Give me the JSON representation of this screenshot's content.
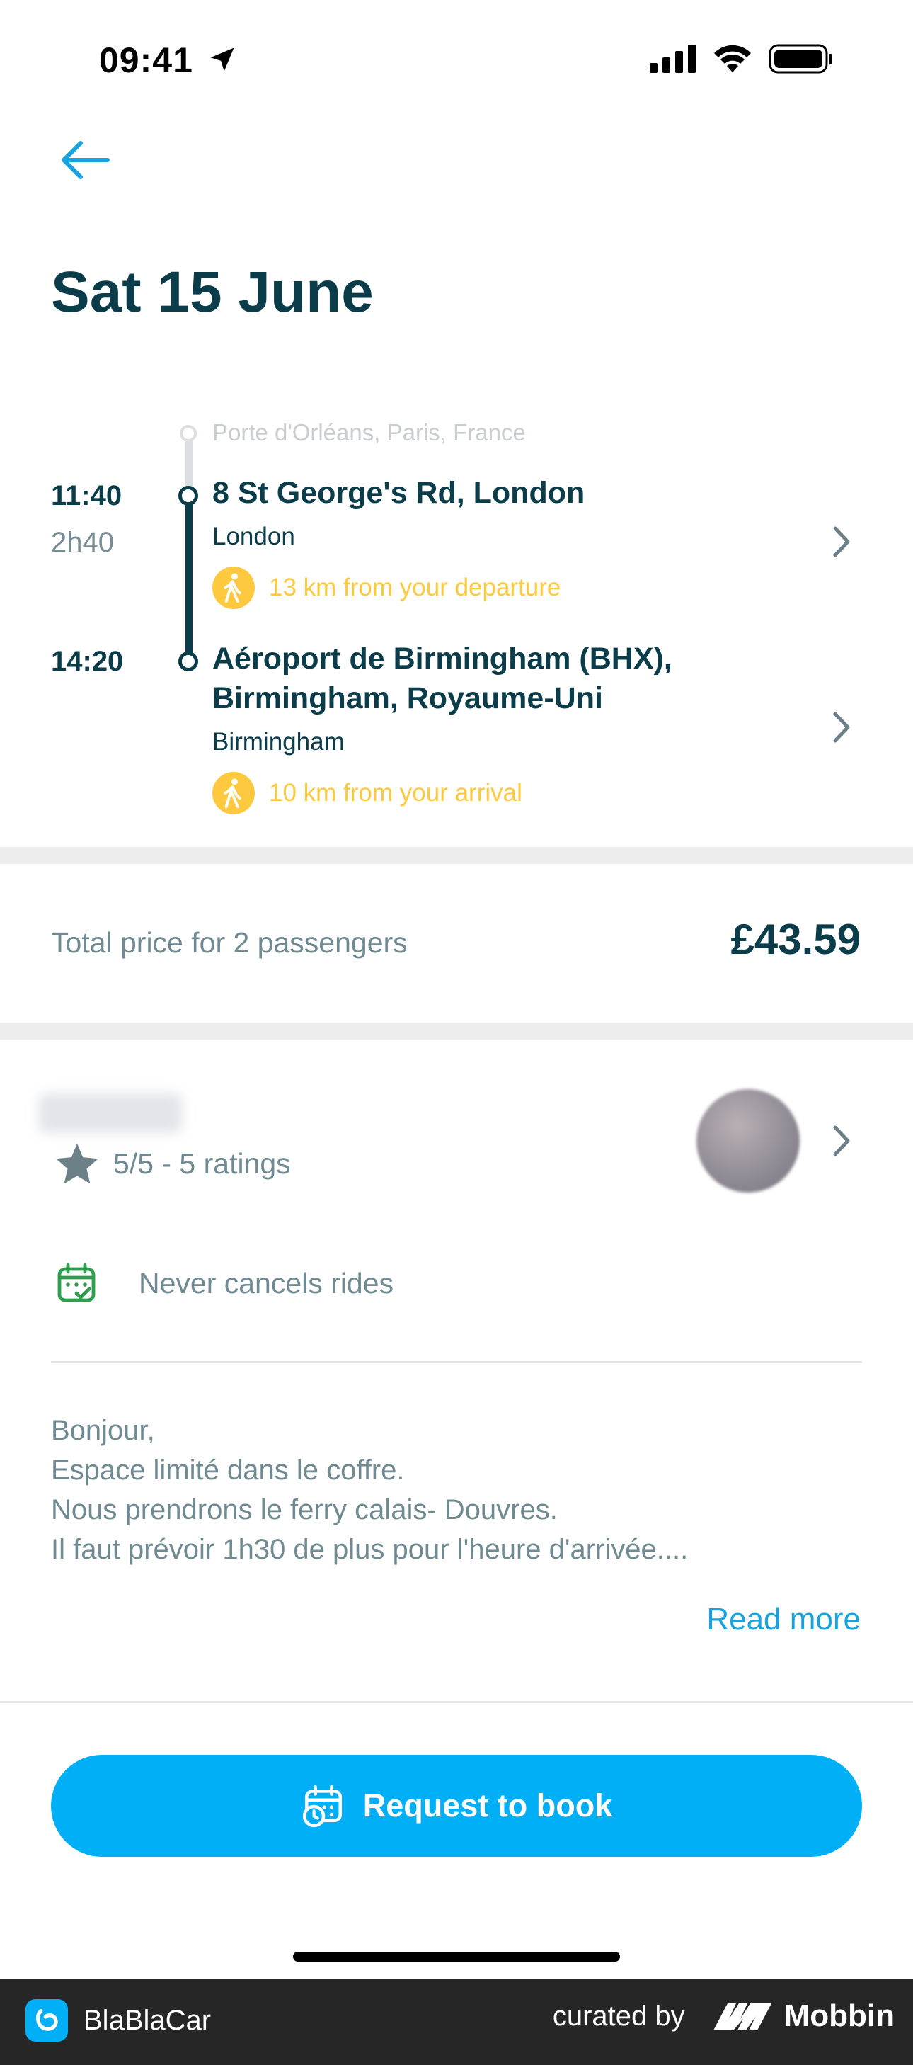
{
  "status_bar": {
    "time": "09:41"
  },
  "header": {
    "title": "Sat 15 June"
  },
  "route": {
    "origin_hint": "Porte d'Orléans, Paris, France",
    "departure": {
      "time": "11:40",
      "duration": "2h40",
      "address": "8 St George's Rd, London",
      "city": "London",
      "walk": "13 km from your departure"
    },
    "arrival": {
      "time": "14:20",
      "address_line1": "Aéroport de Birmingham (BHX),",
      "address_line2": "Birmingham, Royaume-Uni",
      "city": "Birmingham",
      "walk": "10 km from your arrival"
    }
  },
  "price": {
    "label": "Total price for 2 passengers",
    "value": "£43.59"
  },
  "driver": {
    "rating": "5/5 - 5 ratings",
    "never_cancels": "Never cancels rides"
  },
  "description": {
    "lines": [
      "Bonjour,",
      "Espace limité dans le coffre.",
      "Nous prendrons le ferry calais- Douvres.",
      "Il faut prévoir 1h30 de plus pour l'heure d'arrivée...."
    ],
    "read_more": "Read more"
  },
  "cta": {
    "label": "Request to book"
  },
  "footer": {
    "app_name": "BlaBlaCar",
    "curated_by": "curated by",
    "brand": "Mobbin"
  },
  "colors": {
    "primary": "#00aff5",
    "text_dark": "#0b3c4a",
    "muted": "#708a92",
    "walk_yellow": "#ffc93f"
  }
}
